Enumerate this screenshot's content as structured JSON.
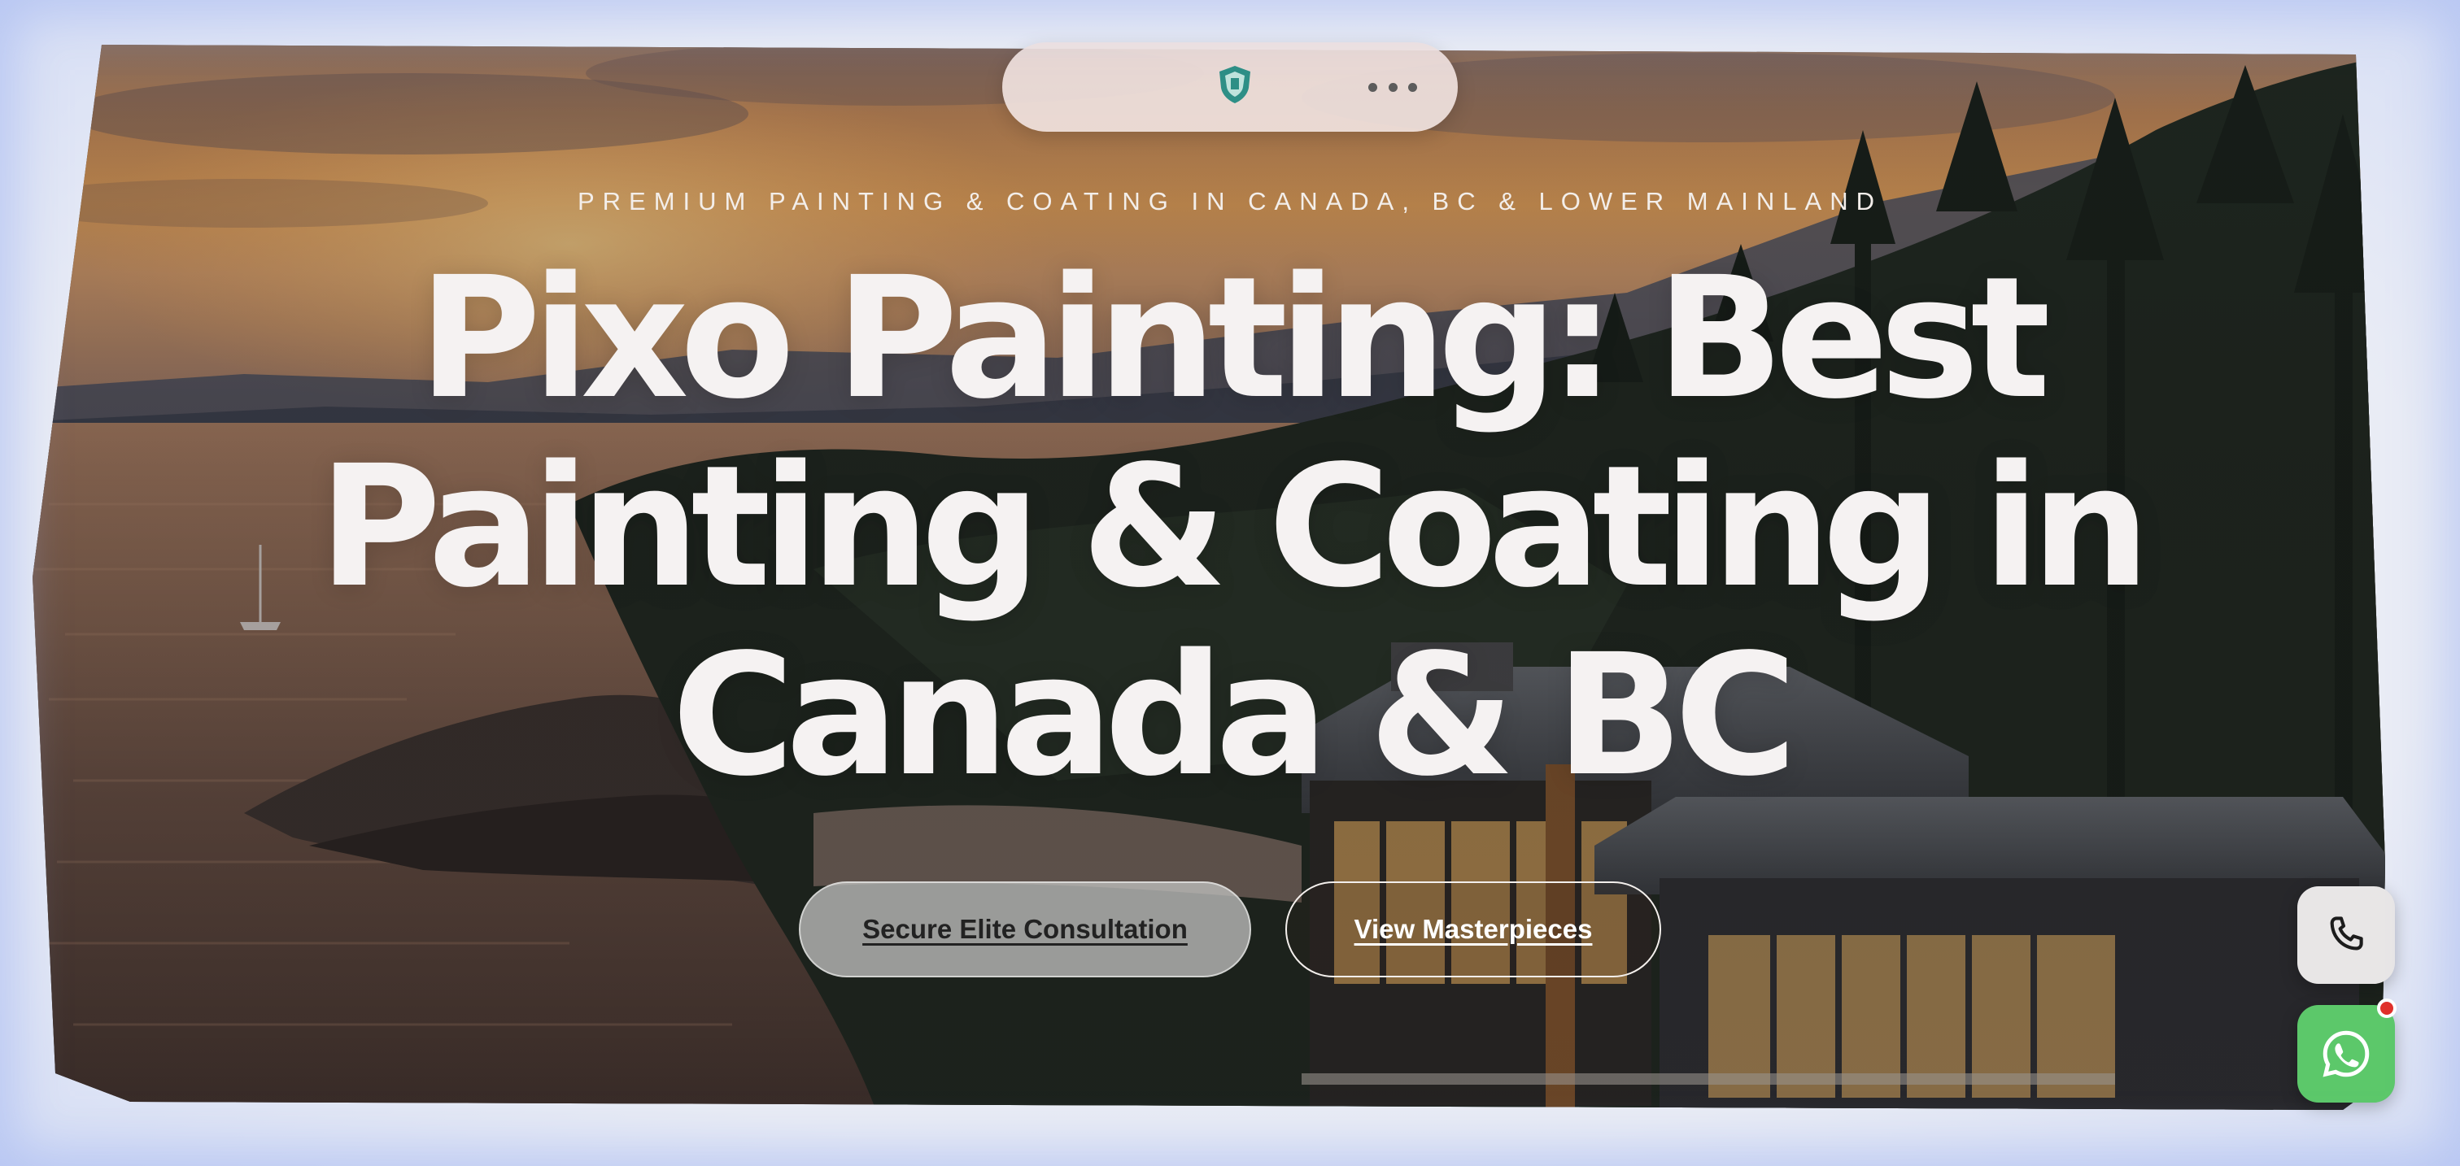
{
  "hero": {
    "tagline": "PREMIUM PAINTING & COATING IN CANADA, BC & LOWER MAINLAND",
    "headline": "Pixo Painting: Best Painting & Coating in Canada & BC",
    "primary_cta": "Secure Elite Consultation",
    "secondary_cta": "View Masterpieces"
  },
  "nav": {
    "logo_icon": "shield-logo-icon",
    "menu_icon": "more-dots-icon"
  },
  "floating_actions": {
    "phone_icon": "phone-icon",
    "whatsapp_icon": "whatsapp-icon"
  },
  "colors": {
    "whatsapp_green": "#5cc86a",
    "notification_red": "#e0302a",
    "headline_text": "#f5f2f2",
    "page_background": "#e9ecf5"
  }
}
